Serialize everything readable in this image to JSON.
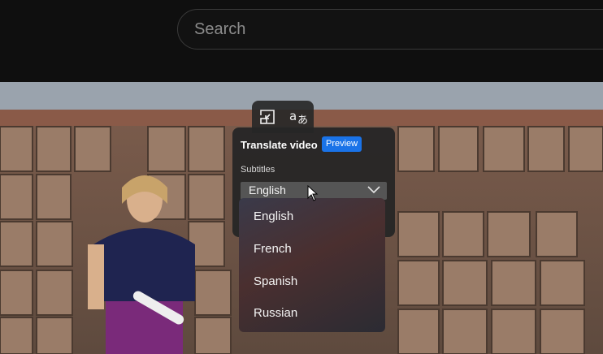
{
  "search": {
    "placeholder": "Search"
  },
  "translate_panel": {
    "title": "Translate video",
    "badge": "Preview",
    "subtitles_label": "Subtitles",
    "selected_language": "English"
  },
  "dropdown": {
    "options": [
      "English",
      "French",
      "Spanish",
      "Russian"
    ]
  },
  "icons": {
    "toolbar": [
      "pip-icon",
      "translate-icon"
    ],
    "select": "chevron-down-icon"
  },
  "colors": {
    "page_bg": "#0f0f0f",
    "badge": "#1a73e8",
    "panel": "#262626"
  }
}
